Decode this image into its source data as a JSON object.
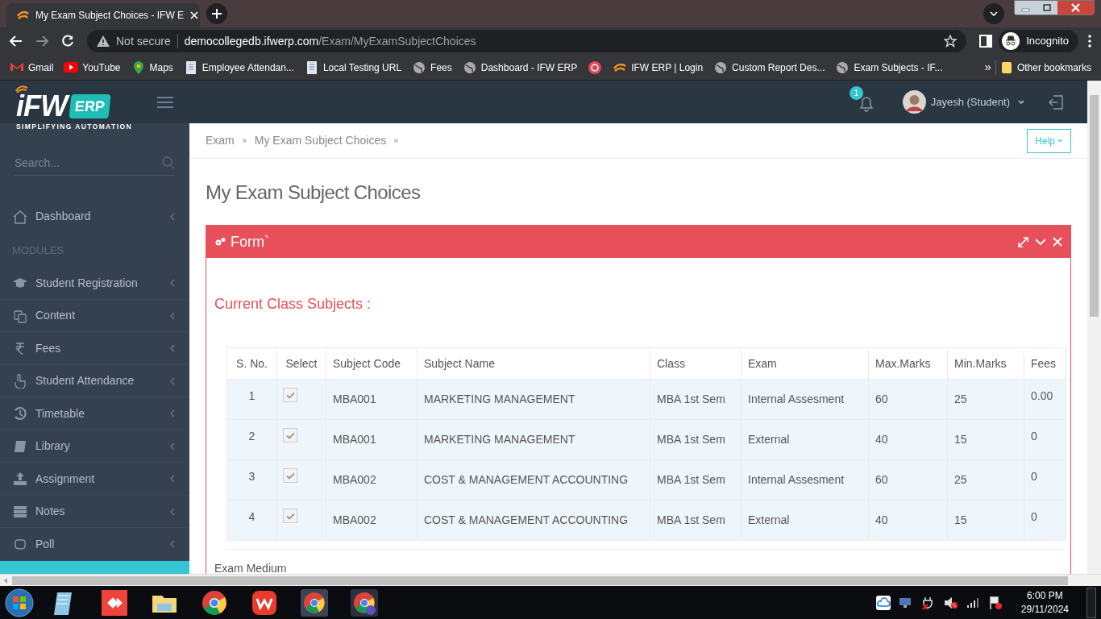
{
  "browser": {
    "tab_title": "My Exam Subject Choices - IFW E",
    "address_host": "democollegedb.ifwerp.com",
    "address_path": "/Exam/MyExamSubjectChoices",
    "security": "Not secure",
    "profile": "Incognito",
    "bookmarks": [
      "Gmail",
      "YouTube",
      "Maps",
      "Employee Attendan...",
      "Local Testing URL",
      "Fees",
      "Dashboard - IFW ERP",
      "IFW ERP | Login",
      "Custom Report Des...",
      "Exam Subjects - IF..."
    ],
    "overflow": "»",
    "other_bookmarks": "Other bookmarks"
  },
  "logo": {
    "brand": "iFW",
    "badge": "ERP",
    "tagline": "SIMPLIFYING AUTOMATION"
  },
  "header": {
    "notifications": "1",
    "user": "Jayesh (Student)"
  },
  "sidebar": {
    "search_placeholder": "Search...",
    "dashboard": "Dashboard",
    "section": "MODULES",
    "items": [
      "Student Registration",
      "Content",
      "Fees",
      "Student Attendance",
      "Timetable",
      "Library",
      "Assignment",
      "Notes",
      "Poll"
    ]
  },
  "breadcrumb": [
    "Exam",
    "My Exam Subject Choices"
  ],
  "help_button": "Help",
  "page_title": "My Exam Subject Choices",
  "panel": {
    "title": "Form`",
    "section_title": "Current Class Subjects :",
    "table": {
      "columns": [
        "S. No.",
        "Select",
        "Subject Code",
        "Subject Name",
        "Class",
        "Exam",
        "Max.Marks",
        "Min.Marks",
        "Fees"
      ],
      "rows": [
        {
          "sno": "1",
          "checked": true,
          "code": "MBA001",
          "name": "MARKETING MANAGEMENT",
          "class": "MBA 1st Sem",
          "exam": "Internal Assesment",
          "max": "60",
          "min": "25",
          "fees": "0.00"
        },
        {
          "sno": "2",
          "checked": true,
          "code": "MBA001",
          "name": "MARKETING MANAGEMENT",
          "class": "MBA 1st Sem",
          "exam": "External",
          "max": "40",
          "min": "15",
          "fees": "0"
        },
        {
          "sno": "3",
          "checked": true,
          "code": "MBA002",
          "name": "COST & MANAGEMENT ACCOUNTING",
          "class": "MBA 1st Sem",
          "exam": "Internal Assesment",
          "max": "60",
          "min": "25",
          "fees": "0"
        },
        {
          "sno": "4",
          "checked": true,
          "code": "MBA002",
          "name": "COST & MANAGEMENT ACCOUNTING",
          "class": "MBA 1st Sem",
          "exam": "External",
          "max": "40",
          "min": "15",
          "fees": "0"
        }
      ]
    },
    "exam_medium_label": "Exam Medium"
  },
  "taskbar": {
    "time": "6:00 PM",
    "date": "29/11/2024"
  }
}
